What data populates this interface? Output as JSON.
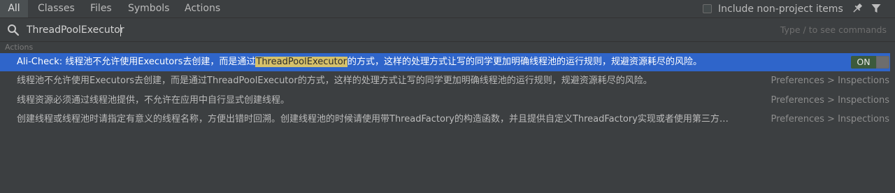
{
  "tabs": [
    {
      "label": "All",
      "active": true
    },
    {
      "label": "Classes",
      "active": false
    },
    {
      "label": "Files",
      "active": false
    },
    {
      "label": "Symbols",
      "active": false
    },
    {
      "label": "Actions",
      "active": false
    }
  ],
  "options": {
    "include_non_project_label": "Include non-project items",
    "include_non_project_checked": false,
    "pin_icon": "pin-icon",
    "filter_icon": "filter-icon"
  },
  "search": {
    "icon": "search-icon",
    "value": "ThreadPoolExecutor",
    "hint": "Type / to see commands"
  },
  "section": {
    "title": "Actions"
  },
  "results": [
    {
      "prefix": "Ali-Check: 线程池不允许使用Executors去创建，而是通过",
      "highlight": "ThreadPoolExecutor",
      "suffix": "的方式，这样的处理方式让写的同学更加明确线程池的运行规则，规避资源耗尽的风险。",
      "toggle_label": "ON",
      "selected": true
    },
    {
      "text": "线程池不允许使用Executors去创建，而是通过ThreadPoolExecutor的方式，这样的处理方式让写的同学更加明确线程池的运行规则，规避资源耗尽的风险。",
      "location": "Preferences > Inspections"
    },
    {
      "text": "线程资源必须通过线程池提供，不允许在应用中自行显式创建线程。",
      "location": "Preferences > Inspections"
    },
    {
      "text": "创建线程或线程池时请指定有意义的线程名称，方便出错时回溯。创建线程池的时候请使用带ThreadFactory的构造函数，并且提供自定义ThreadFactory实现或者使用第三方…",
      "location": "Preferences > Inspections"
    }
  ],
  "colors": {
    "background": "#3c3f41",
    "selection": "#2f65ca",
    "match_highlight": "#d6c16a",
    "toggle_on": "#3c5a3c"
  }
}
